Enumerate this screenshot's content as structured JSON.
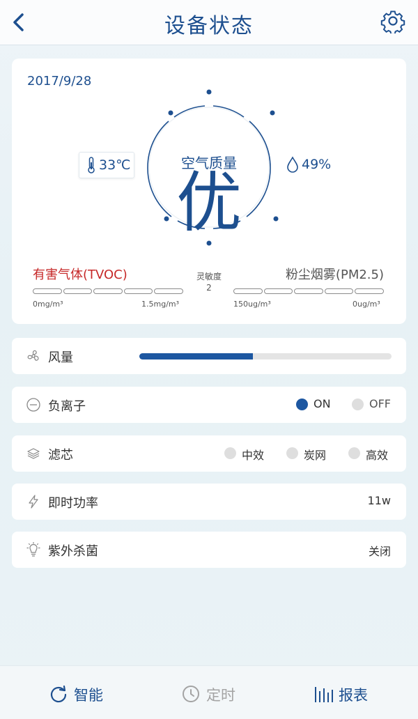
{
  "header": {
    "title": "设备状态",
    "back_icon": "chevron-left-icon",
    "settings_icon": "gear-icon"
  },
  "status": {
    "date": "2017/9/28",
    "air_quality_label": "空气质量",
    "air_quality_value": "优",
    "temperature": "33℃",
    "humidity": "49%",
    "tvoc_label": "有害气体(TVOC)",
    "tvoc_min": "0mg/m³",
    "tvoc_max": "1.5mg/m³",
    "sensitivity_label": "灵敏度",
    "sensitivity_value": "2",
    "pm_label": "粉尘烟雾(PM2.5)",
    "pm_min": "150ug/m³",
    "pm_max": "0ug/m³"
  },
  "controls": {
    "fan": {
      "label": "风量",
      "level_fraction": 0.45
    },
    "anion": {
      "label": "负离子",
      "on_label": "ON",
      "off_label": "OFF",
      "selected": "ON"
    },
    "filter": {
      "label": "滤芯",
      "options": [
        "中效",
        "炭网",
        "高效"
      ]
    },
    "power": {
      "label": "即时功率",
      "value": "11w"
    },
    "uv": {
      "label": "紫外杀菌",
      "value": "关闭"
    }
  },
  "bottom_nav": [
    {
      "label": "智能",
      "icon": "refresh-icon",
      "color": "#1d4f8f"
    },
    {
      "label": "定时",
      "icon": "clock-icon",
      "color": "#a3a3a3"
    },
    {
      "label": "报表",
      "icon": "bars-icon",
      "color": "#1d4f8f"
    }
  ],
  "colors": {
    "primary": "#1d4f8f",
    "accent": "#1d57a1",
    "alert": "#c62828"
  }
}
